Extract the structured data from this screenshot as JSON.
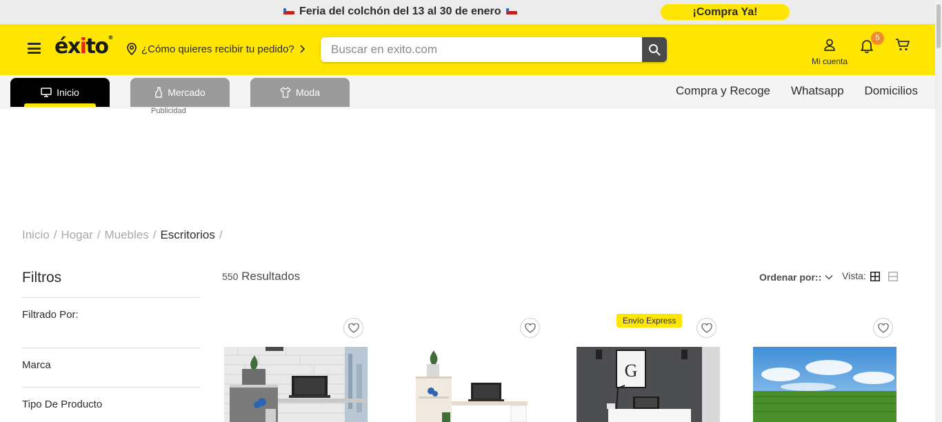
{
  "promo_bar": {
    "text": "Feria del colchón del 13 al 30 de enero",
    "cta": "¡Compra Ya!"
  },
  "header": {
    "logo": "éxito",
    "location": "¿Cómo quieres recibir tu pedido?",
    "search_placeholder": "Buscar en exito.com",
    "account_label": "Mi cuenta",
    "notifications_count": "5",
    "brand_color": "#ffe600"
  },
  "nav": {
    "tabs": [
      {
        "label": "Inicio",
        "active": true
      },
      {
        "label": "Mercado",
        "active": false
      },
      {
        "label": "Moda",
        "active": false
      }
    ],
    "links": [
      "Compra y Recoge",
      "Whatsapp",
      "Domicilios"
    ]
  },
  "ad_label": "Publicidad",
  "breadcrumb": [
    "Inicio",
    "Hogar",
    "Muebles",
    "Escritorios"
  ],
  "sidebar": {
    "title": "Filtros",
    "filtered_by": "Filtrado Por:",
    "groups": [
      "Marca",
      "Tipo De Producto"
    ]
  },
  "results": {
    "count": "550",
    "label": "Resultados",
    "sort_label": "Ordenar por::",
    "view_label": "Vista:"
  },
  "products": [
    {
      "badge": "",
      "image": "desk-gray-white-brick"
    },
    {
      "badge": "",
      "image": "desk-white-oak"
    },
    {
      "badge": "Envío Express",
      "image": "desk-white-dark-room"
    },
    {
      "badge": "",
      "image": "field-sky"
    }
  ]
}
